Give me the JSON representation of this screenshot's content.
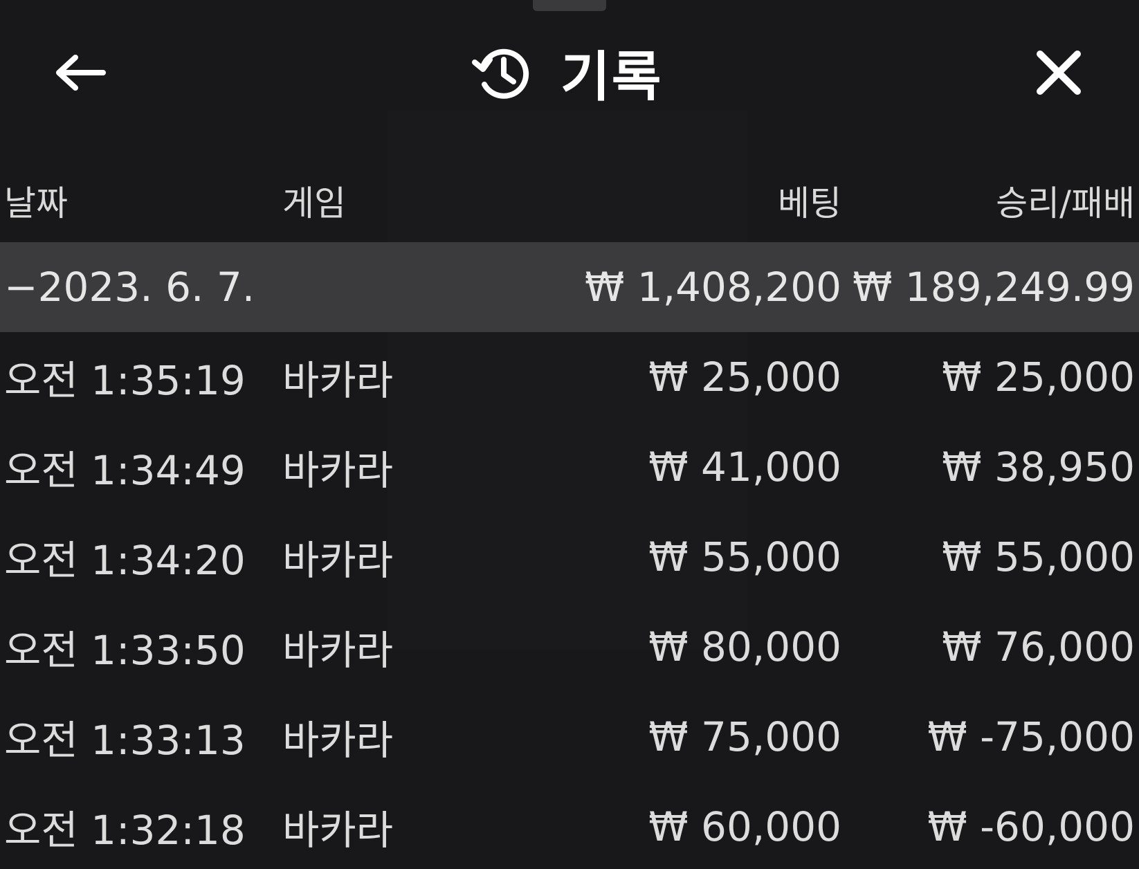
{
  "header": {
    "title": "기록"
  },
  "table": {
    "columns": {
      "date": "날짜",
      "game": "게임",
      "bet": "베팅",
      "result": "승리/패배"
    },
    "summary": {
      "date": "−2023. 6. 7.",
      "bet": "₩ 1,408,200",
      "result": "₩ 189,249.99"
    },
    "rows": [
      {
        "time": "오전 1:35:19",
        "game": "바카라",
        "bet": "₩ 25,000",
        "result": "₩ 25,000"
      },
      {
        "time": "오전 1:34:49",
        "game": "바카라",
        "bet": "₩ 41,000",
        "result": "₩ 38,950"
      },
      {
        "time": "오전 1:34:20",
        "game": "바카라",
        "bet": "₩ 55,000",
        "result": "₩ 55,000"
      },
      {
        "time": "오전 1:33:50",
        "game": "바카라",
        "bet": "₩ 80,000",
        "result": "₩ 76,000"
      },
      {
        "time": "오전 1:33:13",
        "game": "바카라",
        "bet": "₩ 75,000",
        "result": "₩ -75,000"
      },
      {
        "time": "오전 1:32:18",
        "game": "바카라",
        "bet": "₩ 60,000",
        "result": "₩ -60,000"
      }
    ]
  },
  "icons": {
    "back": "arrow-left-icon",
    "history": "history-clock-icon",
    "close": "close-icon"
  },
  "colors": {
    "background": "#18181a",
    "summary_row": "#3b3b3d",
    "text": "#dcdcdc",
    "title": "#ffffff"
  }
}
